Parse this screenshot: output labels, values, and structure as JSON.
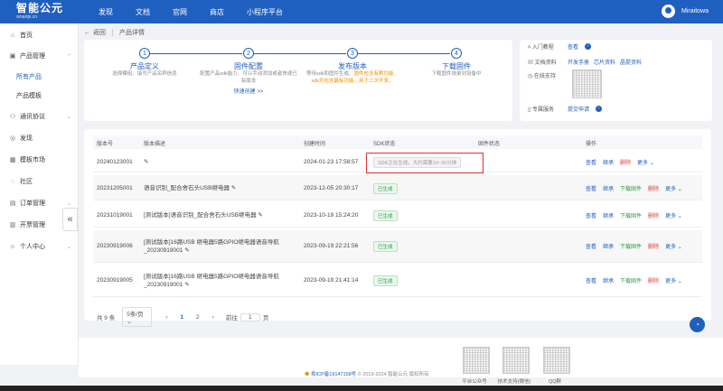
{
  "header": {
    "logo_title": "智能公元",
    "logo_subtitle": "smartpi.cn",
    "nav": [
      "发现",
      "文档",
      "官网",
      "商店",
      "小程序平台"
    ],
    "username": "Miraitowa"
  },
  "sidebar": {
    "items": [
      {
        "icon": "home-icon",
        "label": "首页"
      },
      {
        "icon": "product-icon",
        "label": "产品管理",
        "expanded": true
      },
      {
        "icon": "",
        "label": "所有产品",
        "sub": true,
        "active": true
      },
      {
        "icon": "",
        "label": "产品模板",
        "sub": true
      },
      {
        "icon": "protocol-icon",
        "label": "通讯协议"
      },
      {
        "icon": "discover-icon",
        "label": "发现"
      },
      {
        "icon": "template-icon",
        "label": "模板市场"
      },
      {
        "icon": "community-icon",
        "label": "社区"
      },
      {
        "icon": "order-icon",
        "label": "订单管理"
      },
      {
        "icon": "invoice-icon",
        "label": "开票管理"
      },
      {
        "icon": "user-icon",
        "label": "个人中心"
      }
    ]
  },
  "breadcrumb": {
    "back": "返回",
    "current": "产品详情"
  },
  "steps": [
    {
      "num": "1",
      "title": "产品定义",
      "desc": "选择模组、填写产品名称信息"
    },
    {
      "num": "2",
      "title": "固件配置",
      "desc": "配置产品sdk能力、可以手动添加或者快速已有版本",
      "link": "快速创建 >>"
    },
    {
      "num": "3",
      "title": "发布版本",
      "desc_prefix": "等待sdk和固件生成、",
      "desc_orange": "固件包含有默功能、sdk开包含最标功能，用于二次开发。"
    },
    {
      "num": "4",
      "title": "下载固件",
      "desc": "下载固件烧录到设备中"
    }
  ],
  "resources": {
    "intro_label": "入门教程",
    "intro_link": "查看",
    "docs_label": "文档资料",
    "docs_links": [
      "开发手册",
      "芯片资料",
      "晶提资料"
    ],
    "support_label": "在线支持",
    "service_label": "专属服务",
    "service_link": "提交申请"
  },
  "table": {
    "headers": [
      "版本号",
      "版本描述",
      "创建时间",
      "SDK状态",
      "固件状态",
      "操作"
    ],
    "rows": [
      {
        "version": "20240123001",
        "desc": "",
        "time": "2024-01-23 17:58:57",
        "sdk": "SDK正在生成，大约需要10~30分钟",
        "sdk_state": "generating",
        "ops": [
          "查看",
          "继承",
          "删除",
          "更多 ⌄"
        ]
      },
      {
        "version": "20231205001",
        "desc": "语音识别_配合舍石头USB继电器",
        "time": "2023-12-05 20:30:17",
        "sdk": "已生成",
        "sdk_state": "done",
        "ops": [
          "查看",
          "继承",
          "下载固件",
          "删除",
          "更多 ⌄"
        ]
      },
      {
        "version": "20231019001",
        "desc": "[测试版本]语音识别_配合舍石头USB继电器",
        "time": "2023-10-19 15:24:20",
        "sdk": "已生成",
        "sdk_state": "done",
        "ops": [
          "查看",
          "继承",
          "下载固件",
          "删除",
          "更多 ⌄"
        ]
      },
      {
        "version": "20230919006",
        "desc": "[测试版本]16路USB 继电器5路GPIO继电器语音导航_20230919001",
        "time": "2023-09-19 22:21:56",
        "sdk": "已生成",
        "sdk_state": "done",
        "ops": [
          "查看",
          "继承",
          "下载固件",
          "删除",
          "更多 ⌄"
        ]
      },
      {
        "version": "20230919005",
        "desc": "[测试版本]16路USB 继电器5路GPIO继电器语音导航_20230919001",
        "time": "2023-09-19 21:41:14",
        "sdk": "已生成",
        "sdk_state": "done",
        "ops": [
          "查看",
          "继承",
          "下载固件",
          "删除",
          "更多 ⌄"
        ]
      }
    ]
  },
  "pagination": {
    "total": "共 9 条",
    "page_size": "5条/页",
    "pages": [
      "1",
      "2"
    ],
    "current_page": "1",
    "goto_prefix": "前往",
    "goto_value": "1",
    "goto_suffix": "页"
  },
  "footer": {
    "icp": "粤ICP备19147158号",
    "copyright": "© 2019-2024 智能公元 版权所有",
    "qr_labels": [
      "平台公众号",
      "技术支持(微信)",
      "QQ群"
    ]
  },
  "colors": {
    "primary": "#1f5fbf",
    "success": "#2c9a44",
    "danger": "#e23b3b",
    "warning": "#f08c00"
  }
}
